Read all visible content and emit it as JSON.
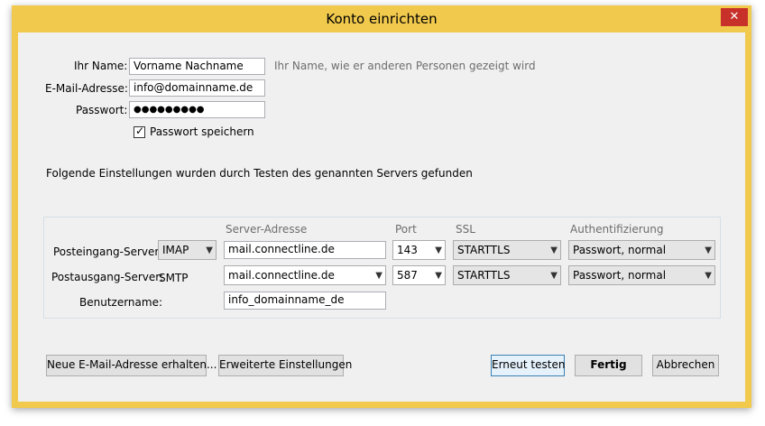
{
  "window": {
    "title": "Konto einrichten",
    "close_glyph": "✕"
  },
  "form": {
    "name_label": "Ihr Name:",
    "name_value": "Vorname Nachname",
    "name_hint": "Ihr Name, wie er anderen Personen gezeigt wird",
    "email_label": "E-Mail-Adresse:",
    "email_value": "info@domainname.de",
    "password_label": "Passwort:",
    "password_value": "●●●●●●●●●",
    "save_password_label": "Passwort speichern",
    "save_password_checked": true
  },
  "found_message": "Folgende Einstellungen wurden durch Testen des genannten Servers gefunden",
  "servers": {
    "headers": {
      "server_address": "Server-Adresse",
      "port": "Port",
      "ssl": "SSL",
      "auth": "Authentifizierung"
    },
    "incoming": {
      "label": "Posteingang-Server:",
      "protocol": "IMAP",
      "address": "mail.connectline.de",
      "port": "143",
      "ssl": "STARTTLS",
      "auth": "Passwort, normal"
    },
    "outgoing": {
      "label": "Postausgang-Server:",
      "protocol": "SMTP",
      "address": "mail.connectline.de",
      "port": "587",
      "ssl": "STARTTLS",
      "auth": "Passwort, normal"
    },
    "username": {
      "label": "Benutzername:",
      "value": "info_domainname_de"
    }
  },
  "buttons": {
    "new_address": "Neue E-Mail-Adresse erhalten...",
    "advanced": "Erweiterte Einstellungen",
    "retest": "Erneut testen",
    "done": "Fertig",
    "cancel": "Abbrechen"
  },
  "colors": {
    "frame": "#f0c94d",
    "close": "#c7312a",
    "client": "#f0f0f0"
  }
}
